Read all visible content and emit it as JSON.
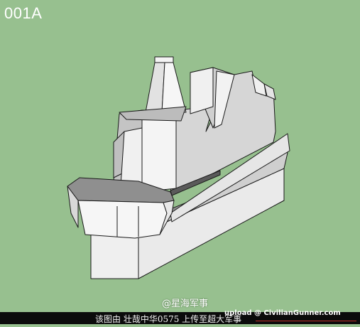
{
  "image": {
    "title": "001A",
    "watermark": "@星海军事",
    "footer_caption": "该图由 壮哉中华0575 上传至超大军事",
    "upload_credit": "upload @ CivilianGunner.com"
  },
  "colors": {
    "background": "#97c08f",
    "model_light": "#f2f2f2",
    "model_mid": "#d8d8d8",
    "model_shade": "#bdbdbd",
    "model_dark": "#8d8d8d",
    "edge": "#1a1a1a",
    "footer_bar": "#0b0b0b",
    "footer_rule": "#c0302a"
  }
}
